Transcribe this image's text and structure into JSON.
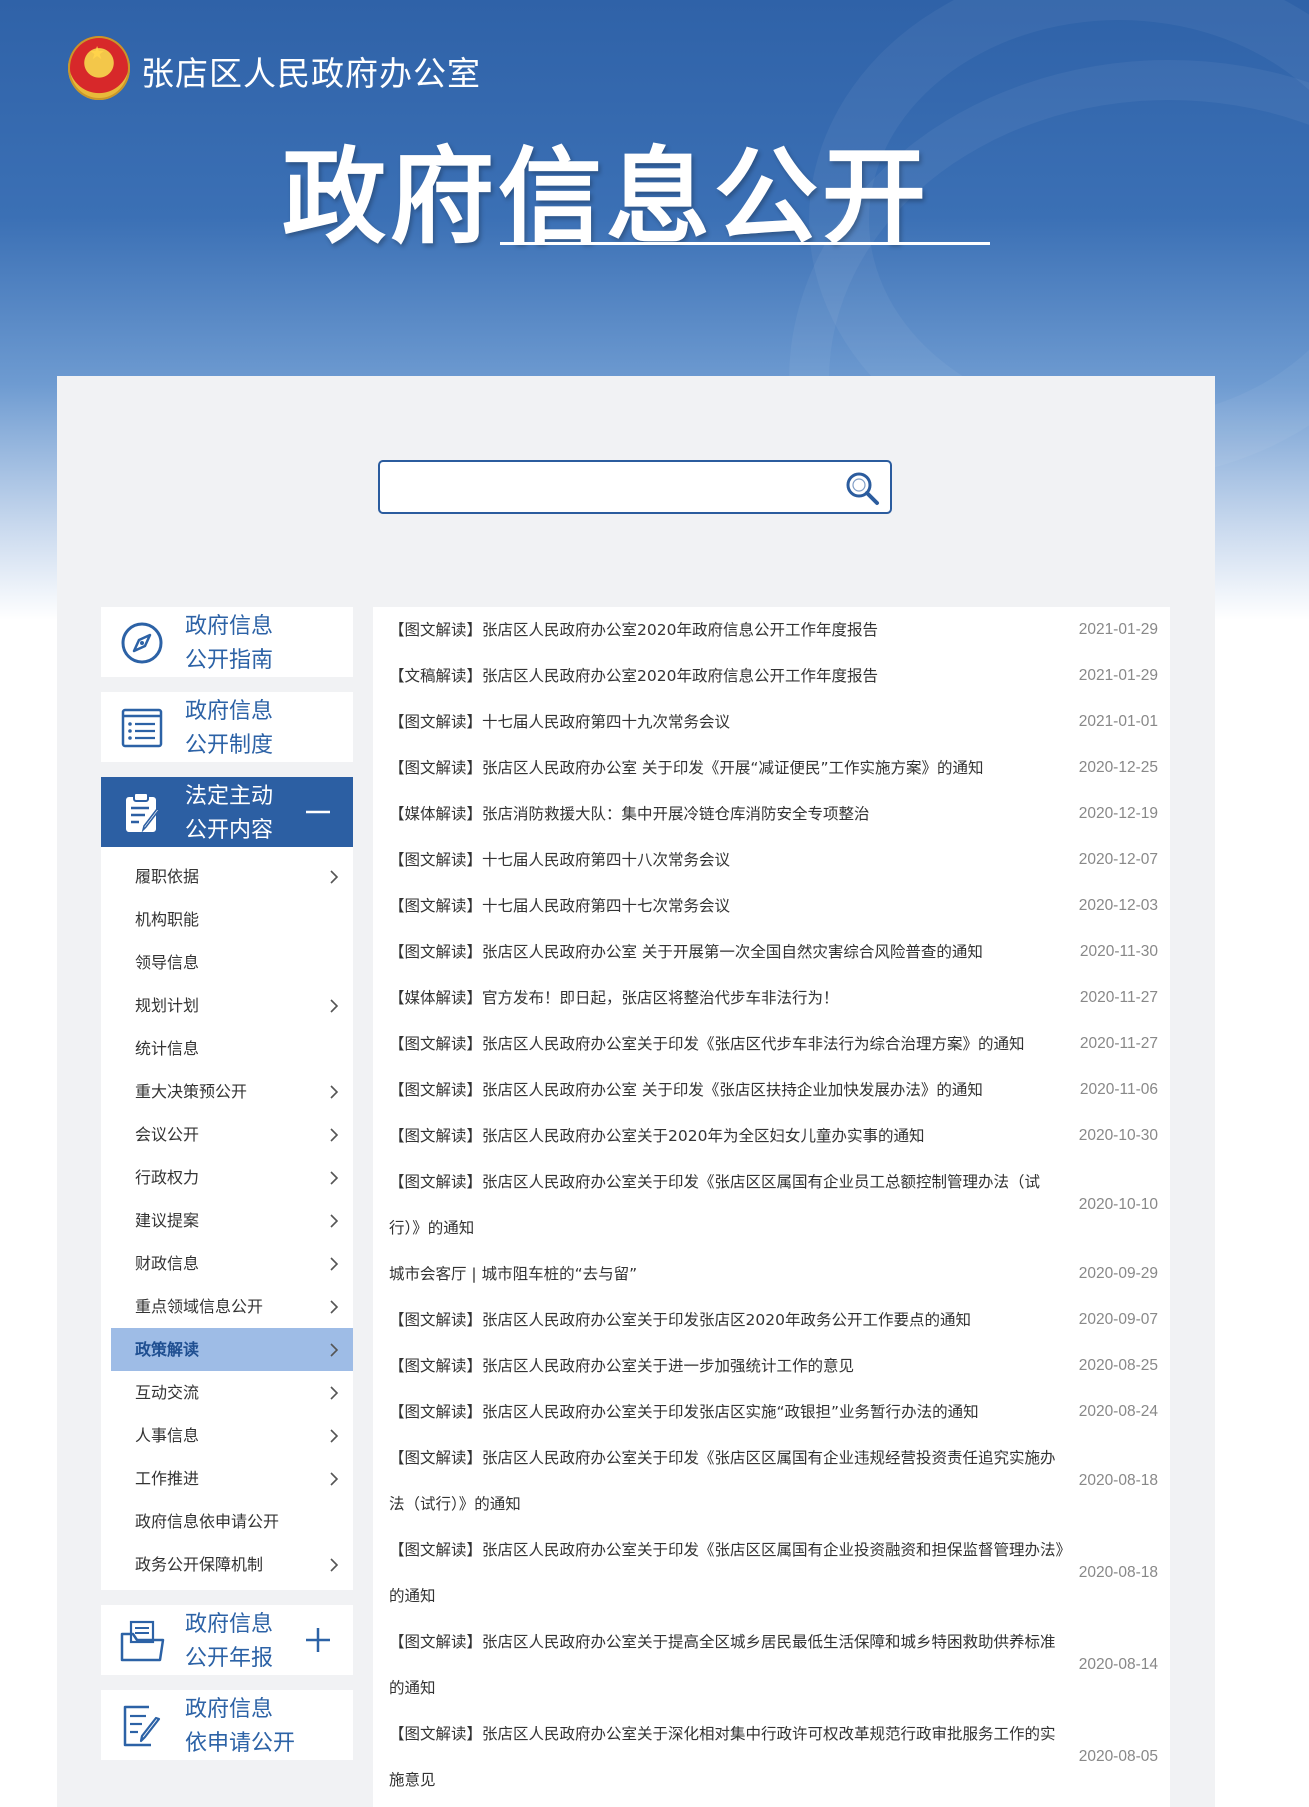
{
  "header": {
    "org_name": "张店区人民政府办公室",
    "page_title": "政府信息公开"
  },
  "search": {
    "placeholder": "",
    "value": ""
  },
  "sidebar": {
    "blocks": [
      {
        "label_line1": "政府信息",
        "label_line2": "公开指南",
        "icon": "compass-icon"
      },
      {
        "label_line1": "政府信息",
        "label_line2": "公开制度",
        "icon": "list-doc-icon"
      },
      {
        "label_line1": "法定主动",
        "label_line2": "公开内容",
        "icon": "clipboard-edit-icon",
        "toggle": "minus-icon"
      },
      {
        "label_line1": "政府信息",
        "label_line2": "公开年报",
        "icon": "folder-doc-icon",
        "toggle": "plus-icon"
      },
      {
        "label_line1": "政府信息",
        "label_line2": "依申请公开",
        "icon": "form-edit-icon"
      }
    ],
    "sub_items": [
      {
        "label": "履职依据",
        "chevron": true
      },
      {
        "label": "机构职能",
        "chevron": false
      },
      {
        "label": "领导信息",
        "chevron": false
      },
      {
        "label": "规划计划",
        "chevron": true
      },
      {
        "label": "统计信息",
        "chevron": false
      },
      {
        "label": "重大决策预公开",
        "chevron": true
      },
      {
        "label": "会议公开",
        "chevron": true
      },
      {
        "label": "行政权力",
        "chevron": true
      },
      {
        "label": "建议提案",
        "chevron": true
      },
      {
        "label": "财政信息",
        "chevron": true
      },
      {
        "label": "重点领域信息公开",
        "chevron": true
      },
      {
        "label": "政策解读",
        "chevron": true,
        "selected": true
      },
      {
        "label": "互动交流",
        "chevron": true
      },
      {
        "label": "人事信息",
        "chevron": true
      },
      {
        "label": "工作推进",
        "chevron": true
      },
      {
        "label": "政府信息依申请公开",
        "chevron": false
      },
      {
        "label": "政务公开保障机制",
        "chevron": true
      }
    ]
  },
  "articles": [
    {
      "title": "【图文解读】张店区人民政府办公室2020年政府信息公开工作年度报告",
      "date": "2021-01-29"
    },
    {
      "title": "【文稿解读】张店区人民政府办公室2020年政府信息公开工作年度报告",
      "date": "2021-01-29"
    },
    {
      "title": "【图文解读】十七届人民政府第四十九次常务会议",
      "date": "2021-01-01"
    },
    {
      "title": "【图文解读】张店区人民政府办公室 关于印发《开展“减证便民”工作实施方案》的通知",
      "date": "2020-12-25"
    },
    {
      "title": "【媒体解读】张店消防救援大队：集中开展冷链仓库消防安全专项整治",
      "date": "2020-12-19"
    },
    {
      "title": "【图文解读】十七届人民政府第四十八次常务会议",
      "date": "2020-12-07"
    },
    {
      "title": "【图文解读】十七届人民政府第四十七次常务会议",
      "date": "2020-12-03"
    },
    {
      "title": "【图文解读】张店区人民政府办公室 关于开展第一次全国自然灾害综合风险普查的通知",
      "date": "2020-11-30"
    },
    {
      "title": "【媒体解读】官方发布！即日起，张店区将整治代步车非法行为！",
      "date": "2020-11-27"
    },
    {
      "title": "【图文解读】张店区人民政府办公室关于印发《张店区代步车非法行为综合治理方案》的通知",
      "date": "2020-11-27"
    },
    {
      "title": "【图文解读】张店区人民政府办公室 关于印发《张店区扶持企业加快发展办法》的通知",
      "date": "2020-11-06"
    },
    {
      "title": "【图文解读】张店区人民政府办公室关于2020年为全区妇女儿童办实事的通知",
      "date": "2020-10-30"
    },
    {
      "title": "【图文解读】张店区人民政府办公室关于印发《张店区区属国有企业员工总额控制管理办法（试行）》的通知",
      "date": "2020-10-10",
      "wrap": true
    },
    {
      "title": "城市会客厅 | 城市阻车桩的“去与留”",
      "date": "2020-09-29"
    },
    {
      "title": "【图文解读】张店区人民政府办公室关于印发张店区2020年政务公开工作要点的通知",
      "date": "2020-09-07"
    },
    {
      "title": "【图文解读】张店区人民政府办公室关于进一步加强统计工作的意见",
      "date": "2020-08-25"
    },
    {
      "title": "【图文解读】张店区人民政府办公室关于印发张店区实施“政银担”业务暂行办法的通知",
      "date": "2020-08-24"
    },
    {
      "title": "【图文解读】张店区人民政府办公室关于印发《张店区区属国有企业违规经营投资责任追究实施办法（试行）》的通知",
      "date": "2020-08-18",
      "wrap": true
    },
    {
      "title": "【图文解读】张店区人民政府办公室关于印发《张店区区属国有企业投资融资和担保监督管理办法》的通知",
      "date": "2020-08-18",
      "wrap": true
    },
    {
      "title": "【图文解读】张店区人民政府办公室关于提高全区城乡居民最低生活保障和城乡特困救助供养标准的通知",
      "date": "2020-08-14",
      "wrap": true
    },
    {
      "title": "【图文解读】张店区人民政府办公室关于深化相对集中行政许可权改革规范行政审批服务工作的实施意见",
      "date": "2020-08-05",
      "wrap": true
    }
  ]
}
